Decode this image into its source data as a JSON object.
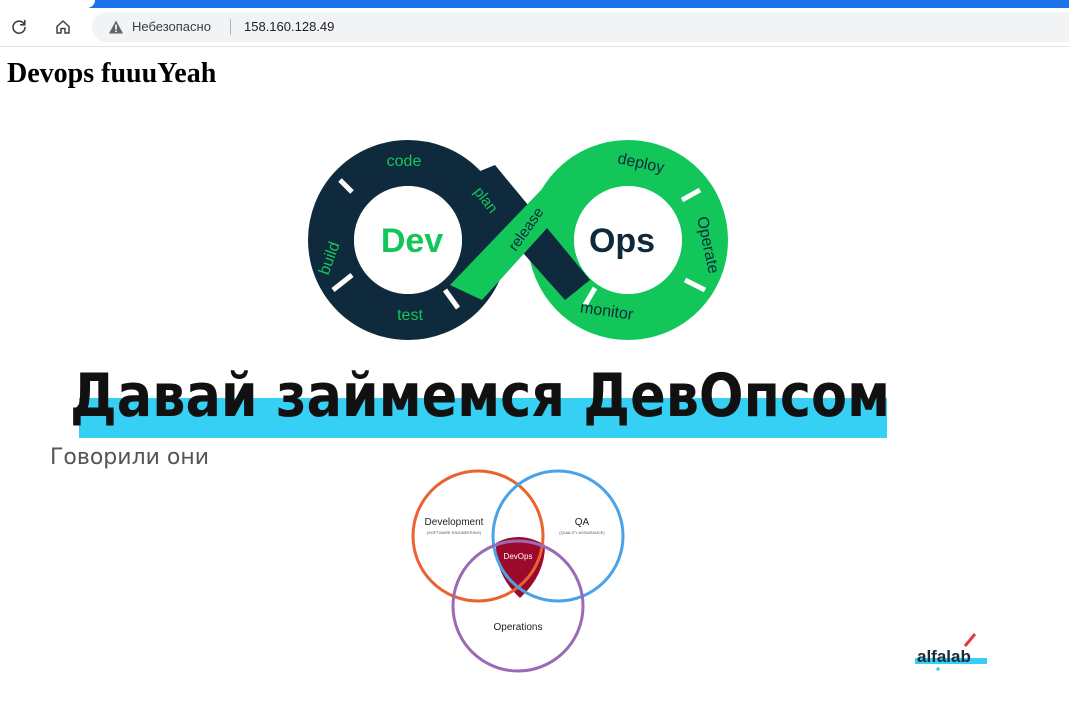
{
  "browser": {
    "security_label": "Небезопасно",
    "url": "158.160.128.49",
    "icons": [
      "reload-icon",
      "home-icon",
      "warning-icon"
    ]
  },
  "page": {
    "heading": "Devops fuuuYeah"
  },
  "banner": {
    "infinity_labels": {
      "code": "code",
      "build": "build",
      "test": "test",
      "plan": "plan",
      "release": "release",
      "deploy": "deploy",
      "operate": "Operate",
      "monitor": "monitor",
      "dev": "Dev",
      "ops": "Ops"
    },
    "title": "Давай займемся ДевОпсом",
    "subtitle": "Говорили они",
    "venn": {
      "development": "Development",
      "development_sub": "(SOFTWARE ENGINEERING)",
      "qa": "QA",
      "qa_sub": "(QUALITY ASSURANCE)",
      "operations": "Operations",
      "center": "DevOps"
    },
    "logo": "alfalab"
  },
  "colors": {
    "navy": "#0f2a3d",
    "green": "#12c65a",
    "highlight": "#37d0f5",
    "venn_orange": "#e8632f",
    "venn_blue": "#4aa3e8",
    "venn_purple": "#9a6ab5",
    "venn_center": "#9b0a2d",
    "chrome_blue": "#1a73e8"
  }
}
